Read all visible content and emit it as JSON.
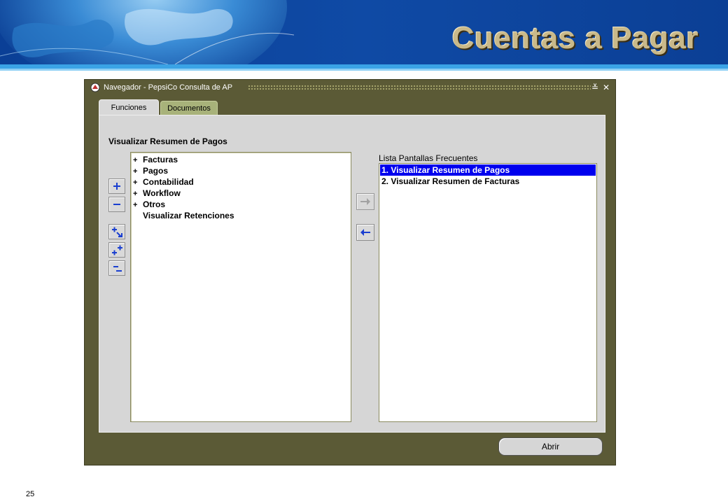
{
  "slide": {
    "title": "Cuentas a Pagar",
    "page_number": "25"
  },
  "window": {
    "title": "Navegador - PepsiCo Consulta de AP",
    "minimize_glyph": "≚",
    "close_glyph": "✕"
  },
  "tabs": [
    {
      "label": "Funciones",
      "active": true
    },
    {
      "label": "Documentos",
      "active": false
    }
  ],
  "section_title": "Visualizar Resumen de Pagos",
  "tree": {
    "items": [
      {
        "expander": "+",
        "label": "Facturas"
      },
      {
        "expander": "+",
        "label": "Pagos"
      },
      {
        "expander": "+",
        "label": "Contabilidad"
      },
      {
        "expander": "+",
        "label": "Workflow"
      },
      {
        "expander": "+",
        "label": "Otros"
      },
      {
        "expander": "",
        "label": "Visualizar Retenciones"
      }
    ]
  },
  "favorites": {
    "label": "Lista Pantallas Frecuentes",
    "items": [
      {
        "label": "1. Visualizar Resumen de Pagos",
        "selected": true
      },
      {
        "label": "2. Visualizar Resumen de Facturas",
        "selected": false
      }
    ]
  },
  "footer": {
    "open_button_label": "Abrir"
  },
  "icons": {
    "expand": "plus-icon",
    "collapse": "minus-icon",
    "expand_branch": "expand-branch-icon",
    "expand_all": "expand-all-icon",
    "collapse_all": "collapse-all-icon",
    "add_to_list": "arrow-right-icon",
    "remove_from_list": "arrow-left-icon"
  },
  "colors": {
    "window_frame": "#5b5a36",
    "selection": "#0000ee",
    "banner": "#0f4aa5",
    "title_text": "#c9b98a"
  }
}
